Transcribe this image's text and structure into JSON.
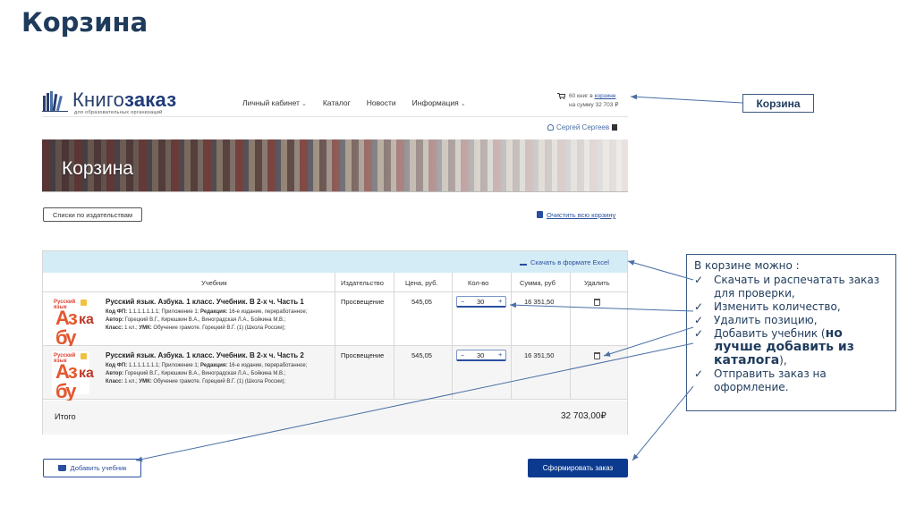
{
  "slide_title": "Корзина",
  "logo": {
    "prefix": "Книго",
    "bold": "заказ",
    "tagline": "для образовательных организаций"
  },
  "nav": [
    {
      "label": "Личный кабинет",
      "has_chevron": true
    },
    {
      "label": "Каталог",
      "has_chevron": false
    },
    {
      "label": "Новости",
      "has_chevron": false
    },
    {
      "label": "Информация",
      "has_chevron": true
    }
  ],
  "cart_mini": {
    "line1_prefix": "60 книг в ",
    "line1_link": "корзине",
    "line2": "на сумму 32 703 ₽"
  },
  "user": {
    "name": "Сергей Сергеев"
  },
  "banner_title": "Корзина",
  "lists_button": "Списки по издательствам",
  "clear_cart": "Очистить всю корзину",
  "download_excel": "Скачать в формате Excel",
  "columns": {
    "book": "Учебник",
    "publisher": "Издательство",
    "price": "Цена, руб.",
    "qty": "Кол-во",
    "sum": "Сумма, руб",
    "delete": "Удалить"
  },
  "rows": [
    {
      "cover_top": "Русский язык",
      "cover_big": "Аз бу",
      "cover_side": "ка",
      "title": "Русский язык. Азбука. 1 класс. Учебник. В 2-х ч. Часть 1",
      "meta_code_label": "Код ФП:",
      "meta_code": " 1.1.1.1.1.1.1; Приложение 1;",
      "meta_ed_label": " Редакция:",
      "meta_ed": " 16-е издание, переработанное;",
      "meta_author_label": "Автор:",
      "meta_author": " Горецкий В.Г., Кирюшкин В.А., Виноградская Л.А., Бойкина М.В.;",
      "meta_class_label": "Класс:",
      "meta_class": " 1 кл.;",
      "meta_umk_label": " УМК:",
      "meta_umk": " Обучение грамоте. Горецкий В.Г. (1) (Школа России);",
      "publisher": "Просвещение",
      "price": "545,05",
      "qty_minus": "−",
      "qty": "30",
      "qty_plus": "+",
      "sum": "16 351,50"
    },
    {
      "cover_top": "Русский язык",
      "cover_big": "Аз бу",
      "cover_side": "ка",
      "title": "Русский язык. Азбука. 1 класс. Учебник. В 2-х ч. Часть 2",
      "meta_code_label": "Код ФП:",
      "meta_code": " 1.1.1.1.1.1.1; Приложение 1;",
      "meta_ed_label": " Редакция:",
      "meta_ed": " 16-е издание, переработанное;",
      "meta_author_label": "Автор:",
      "meta_author": " Горецкий В.Г., Кирюшкин В.А., Виноградская Л.А., Бойкина М.В.;",
      "meta_class_label": "Класс:",
      "meta_class": " 1 кл.;",
      "meta_umk_label": " УМК:",
      "meta_umk": " Обучение грамоте. Горецкий В.Г. (1) (Школа России);",
      "publisher": "Просвещение",
      "price": "545,05",
      "qty_minus": "−",
      "qty": "30",
      "qty_plus": "+",
      "sum": "16 351,50"
    }
  ],
  "total": {
    "label": "Итого",
    "value": "32 703,00₽"
  },
  "add_book_button": "Добавить учебник",
  "submit_button": "Сформировать заказ",
  "callout_cart": "Корзина",
  "callout_list": {
    "head": "В корзине можно :",
    "items": [
      "Скачать и распечатать заказ для проверки,",
      "Изменить количество,",
      "Удалить позицию,"
    ],
    "add_prefix": "Добавить учебник (",
    "add_bold": "но лучше добавить из каталога",
    "add_suffix": "),",
    "last_item": "Отправить заказ на оформление."
  },
  "colors": {
    "primary": "#0b3a8f",
    "link": "#2a4fa0",
    "toolbar_bg": "#d4ecf5",
    "callout_text": "#1f3b5c"
  }
}
